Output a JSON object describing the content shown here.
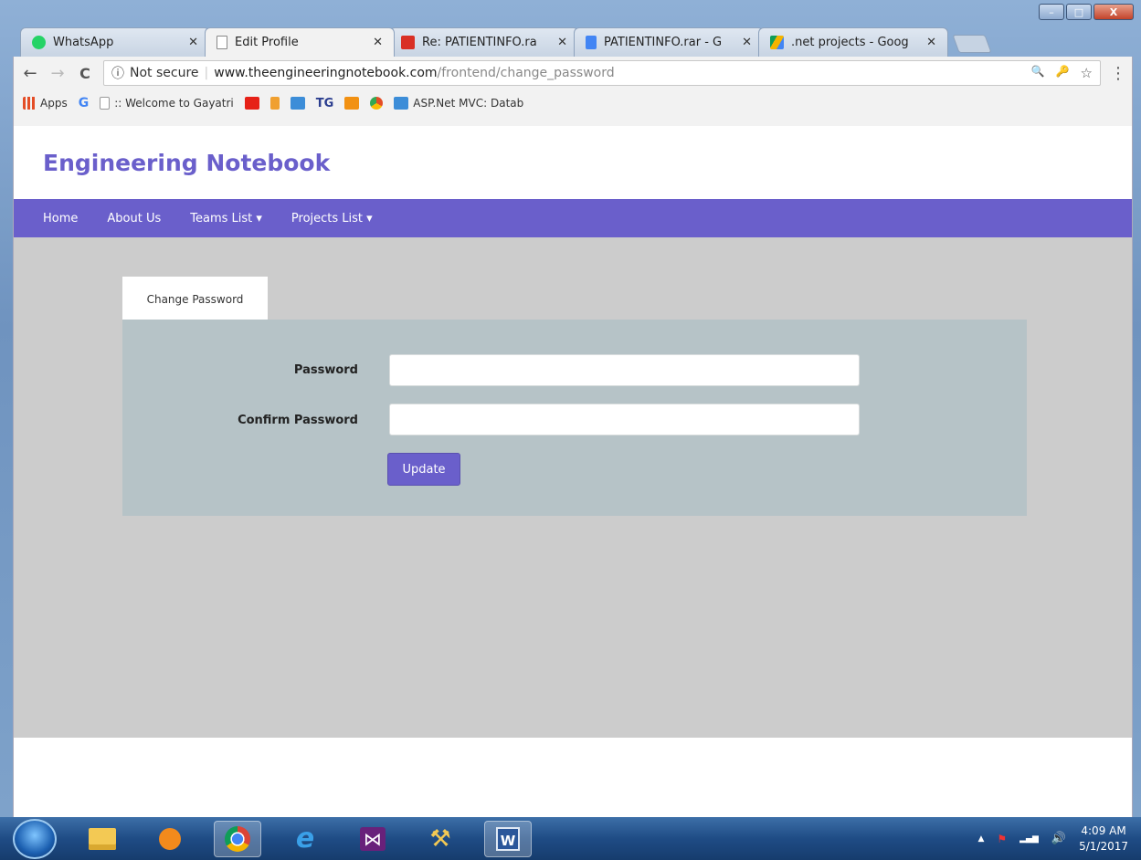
{
  "window": {
    "controls": {
      "minimize": "–",
      "maximize": "□",
      "close": "X"
    }
  },
  "tabs": [
    {
      "title": "WhatsApp",
      "icon": "whatsapp-icon",
      "color": "#25d366",
      "close": "✕"
    },
    {
      "title": "Edit Profile",
      "icon": "page-icon",
      "color": "#888888",
      "close": "✕"
    },
    {
      "title": "Re: PATIENTINFO.ra",
      "icon": "gmail-icon",
      "color": "#d93025",
      "close": "✕"
    },
    {
      "title": "PATIENTINFO.rar - G",
      "icon": "docs-icon",
      "color": "#4285f4",
      "close": "✕"
    },
    {
      "title": ".net projects - Goog",
      "icon": "drive-icon",
      "color": "#0f9d58",
      "close": "✕"
    }
  ],
  "toolbar": {
    "back": "←",
    "forward": "→",
    "reload": "C",
    "security_icon": "ⓘ",
    "security_label": "Not secure",
    "url_host": "www.theengineeringnotebook.com",
    "url_path": "/frontend/change_password",
    "zoom_icon": "🔍",
    "key_icon": "🔑",
    "star_icon": "☆",
    "menu": "⋮"
  },
  "bookmarks": [
    {
      "label": "Apps",
      "icon": "apps-grid-icon",
      "color": "#e44d26"
    },
    {
      "label": "",
      "icon": "google-icon",
      "color": "#4285f4"
    },
    {
      "label": ":: Welcome to Gayatri",
      "icon": "page-icon",
      "color": "#dddddd"
    },
    {
      "label": "",
      "icon": "youtube-icon",
      "color": "#e62117"
    },
    {
      "label": "",
      "icon": "bookmark-icon",
      "color": "#f0a030"
    },
    {
      "label": "",
      "icon": "calendar-icon",
      "color": "#3c8dd8"
    },
    {
      "label": "",
      "icon": "tg-icon",
      "color": "#2b3e8f"
    },
    {
      "label": "",
      "icon": "grid-icon",
      "color": "#f29112"
    },
    {
      "label": "",
      "icon": "chrome-store-icon",
      "color": "#e44d26"
    },
    {
      "label": "ASP.Net MVC: Datab",
      "icon": "aspnet-icon",
      "color": "#3c8dd8"
    }
  ],
  "site": {
    "brand": "Engineering Notebook",
    "nav": [
      "Home",
      "About Us",
      "Teams List ▾",
      "Projects List ▾"
    ],
    "accent": "#6a5fcb"
  },
  "form": {
    "tab_label": "Change Password",
    "password_label": "Password",
    "password_value": "",
    "confirm_label": "Confirm Password",
    "confirm_value": "",
    "submit_label": "Update"
  },
  "taskbar": {
    "apps": [
      {
        "name": "explorer-icon",
        "glyph": "📁",
        "active": false
      },
      {
        "name": "media-player-icon",
        "glyph": "▶",
        "active": false
      },
      {
        "name": "chrome-icon",
        "glyph": "◉",
        "active": true
      },
      {
        "name": "ie-icon",
        "glyph": "e",
        "active": false
      },
      {
        "name": "visual-studio-icon",
        "glyph": "⋈",
        "active": false
      },
      {
        "name": "tools-icon",
        "glyph": "⚒",
        "active": false
      },
      {
        "name": "word-icon",
        "glyph": "W",
        "active": true
      }
    ],
    "tray": {
      "expand": "▲",
      "flag": "⚑",
      "network": "▂▄▆",
      "volume": "🔊"
    },
    "time": "4:09 AM",
    "date": "5/1/2017"
  }
}
